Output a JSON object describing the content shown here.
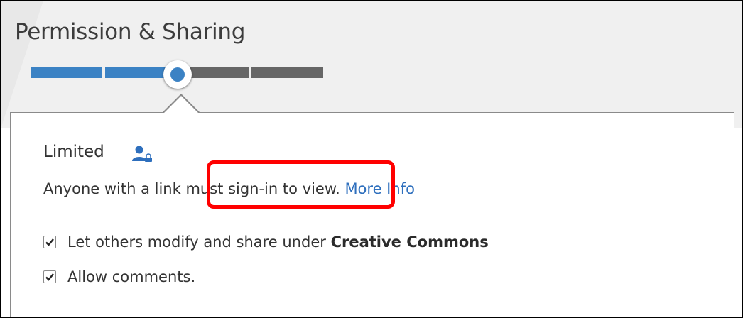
{
  "title": "Permission & Sharing",
  "stepper": {
    "steps_total": 4,
    "selected_step": 2,
    "filled_color": "#3b82c4",
    "empty_color": "#666666"
  },
  "panel": {
    "heading": "Limited",
    "heading_icon": "limited-user-icon",
    "description_before": "Anyone with a link ",
    "description_emphasis": "must sign-in to view.",
    "more_info_link": "More Info",
    "options": [
      {
        "checked": true,
        "label_prefix": "Let others modify and share under ",
        "label_bold": "Creative Commons"
      },
      {
        "checked": true,
        "label_prefix": "Allow comments.",
        "label_bold": ""
      }
    ]
  },
  "annotation": {
    "color": "#ff0000"
  }
}
